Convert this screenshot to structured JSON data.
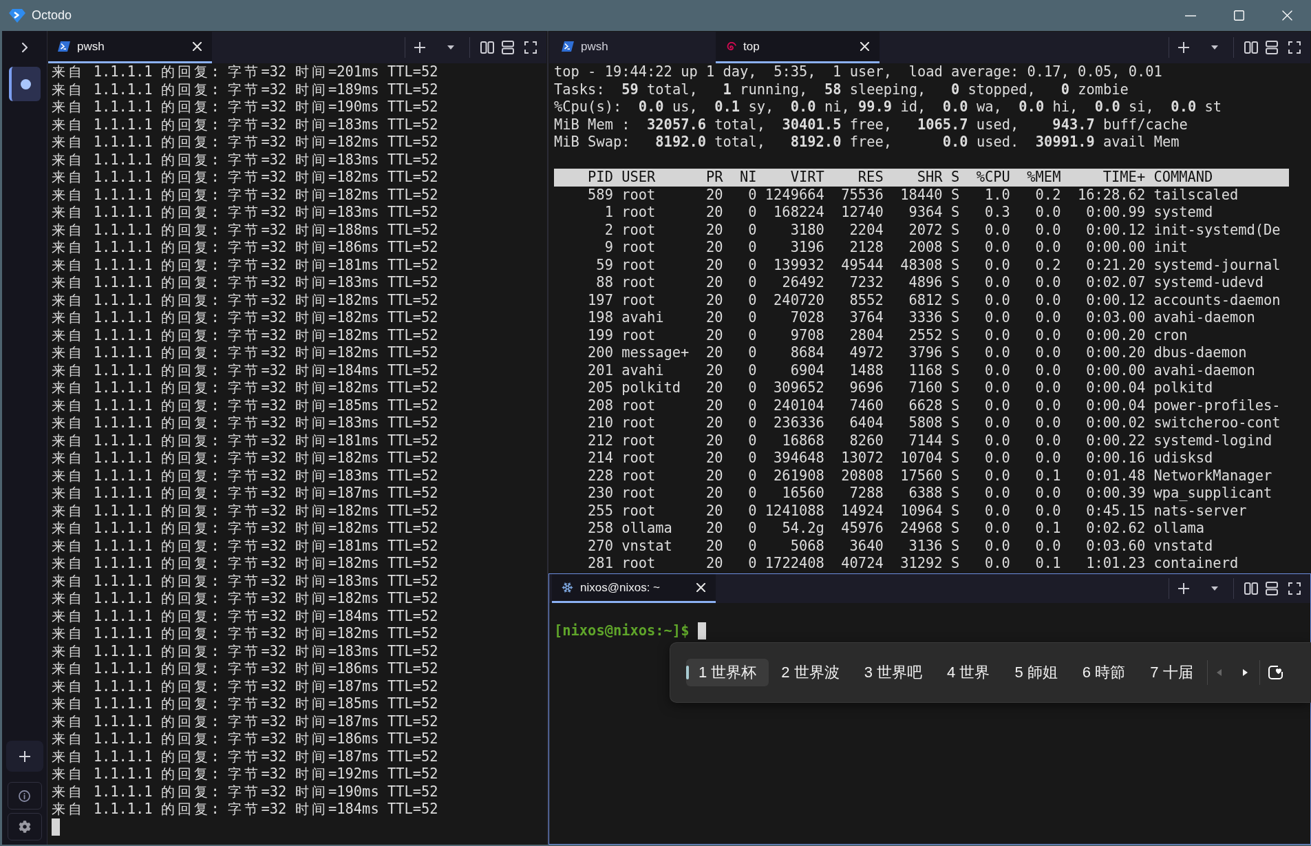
{
  "window": {
    "title": "Octodo"
  },
  "sidebar": {
    "sessions": [
      {
        "selected": true
      }
    ]
  },
  "panes": [
    {
      "kind": "output",
      "focused": false,
      "cursor": true,
      "tabs": [
        {
          "kind": "powershell",
          "label": "pwsh",
          "selected": true
        }
      ],
      "lines": [
        "来自 1.1.1.1 的回复: 字节=32 时间=201ms TTL=52",
        "来自 1.1.1.1 的回复: 字节=32 时间=189ms TTL=52",
        "来自 1.1.1.1 的回复: 字节=32 时间=190ms TTL=52",
        "来自 1.1.1.1 的回复: 字节=32 时间=183ms TTL=52",
        "来自 1.1.1.1 的回复: 字节=32 时间=182ms TTL=52",
        "来自 1.1.1.1 的回复: 字节=32 时间=183ms TTL=52",
        "来自 1.1.1.1 的回复: 字节=32 时间=182ms TTL=52",
        "来自 1.1.1.1 的回复: 字节=32 时间=182ms TTL=52",
        "来自 1.1.1.1 的回复: 字节=32 时间=183ms TTL=52",
        "来自 1.1.1.1 的回复: 字节=32 时间=188ms TTL=52",
        "来自 1.1.1.1 的回复: 字节=32 时间=186ms TTL=52",
        "来自 1.1.1.1 的回复: 字节=32 时间=181ms TTL=52",
        "来自 1.1.1.1 的回复: 字节=32 时间=183ms TTL=52",
        "来自 1.1.1.1 的回复: 字节=32 时间=182ms TTL=52",
        "来自 1.1.1.1 的回复: 字节=32 时间=182ms TTL=52",
        "来自 1.1.1.1 的回复: 字节=32 时间=182ms TTL=52",
        "来自 1.1.1.1 的回复: 字节=32 时间=182ms TTL=52",
        "来自 1.1.1.1 的回复: 字节=32 时间=184ms TTL=52",
        "来自 1.1.1.1 的回复: 字节=32 时间=182ms TTL=52",
        "来自 1.1.1.1 的回复: 字节=32 时间=185ms TTL=52",
        "来自 1.1.1.1 的回复: 字节=32 时间=183ms TTL=52",
        "来自 1.1.1.1 的回复: 字节=32 时间=181ms TTL=52",
        "来自 1.1.1.1 的回复: 字节=32 时间=182ms TTL=52",
        "来自 1.1.1.1 的回复: 字节=32 时间=183ms TTL=52",
        "来自 1.1.1.1 的回复: 字节=32 时间=187ms TTL=52",
        "来自 1.1.1.1 的回复: 字节=32 时间=182ms TTL=52",
        "来自 1.1.1.1 的回复: 字节=32 时间=182ms TTL=52",
        "来自 1.1.1.1 的回复: 字节=32 时间=181ms TTL=52",
        "来自 1.1.1.1 的回复: 字节=32 时间=182ms TTL=52",
        "来自 1.1.1.1 的回复: 字节=32 时间=183ms TTL=52",
        "来自 1.1.1.1 的回复: 字节=32 时间=182ms TTL=52",
        "来自 1.1.1.1 的回复: 字节=32 时间=184ms TTL=52",
        "来自 1.1.1.1 的回复: 字节=32 时间=182ms TTL=52",
        "来自 1.1.1.1 的回复: 字节=32 时间=183ms TTL=52",
        "来自 1.1.1.1 的回复: 字节=32 时间=186ms TTL=52",
        "来自 1.1.1.1 的回复: 字节=32 时间=187ms TTL=52",
        "来自 1.1.1.1 的回复: 字节=32 时间=185ms TTL=52",
        "来自 1.1.1.1 的回复: 字节=32 时间=187ms TTL=52",
        "来自 1.1.1.1 的回复: 字节=32 时间=186ms TTL=52",
        "来自 1.1.1.1 的回复: 字节=32 时间=187ms TTL=52",
        "来自 1.1.1.1 的回复: 字节=32 时间=192ms TTL=52",
        "来自 1.1.1.1 的回复: 字节=32 时间=190ms TTL=52",
        "来自 1.1.1.1 的回复: 字节=32 时间=184ms TTL=52"
      ]
    },
    {
      "kind": "process_monitor",
      "focused": false,
      "cursor": false,
      "tabs": [
        {
          "kind": "powershell",
          "label": "pwsh",
          "selected": false
        },
        {
          "kind": "debian",
          "label": "top",
          "selected": true
        }
      ],
      "summary": [
        "top - 19:44:22 up 1 day,  5:35,  1 user,  load average: 0.17, 0.05, 0.01",
        "Tasks:  **59** total,   **1** running,  **58** sleeping,   **0** stopped,   **0** zombie",
        "%Cpu(s):  **0.0** us,  **0.1** sy,  **0.0** ni, **99.9** id,  **0.0** wa,  **0.0** hi,  **0.0** si,  **0.0** st",
        "MiB Mem :  **32057.6** total,  **30401.5** free,   **1065.7** used,    **943.7** buff/cache",
        "MiB Swap:   **8192.0** total,   **8192.0** free,      **0.0** used.  **30991.9** avail Mem"
      ],
      "table": {
        "columns": [
          "PID",
          "USER",
          "PR",
          "NI",
          "VIRT",
          "RES",
          "SHR",
          "S",
          "%CPU",
          "%MEM",
          "TIME+",
          "COMMAND"
        ],
        "rows": [
          [
            "589",
            "root",
            "20",
            "0",
            "1249664",
            "75536",
            "18440",
            "S",
            "1.0",
            "0.2",
            "16:28.62",
            "tailscaled"
          ],
          [
            "1",
            "root",
            "20",
            "0",
            "168224",
            "12740",
            "9364",
            "S",
            "0.3",
            "0.0",
            "0:00.99",
            "systemd"
          ],
          [
            "2",
            "root",
            "20",
            "0",
            "3180",
            "2204",
            "2072",
            "S",
            "0.0",
            "0.0",
            "0:00.12",
            "init-systemd(De"
          ],
          [
            "9",
            "root",
            "20",
            "0",
            "3196",
            "2128",
            "2008",
            "S",
            "0.0",
            "0.0",
            "0:00.00",
            "init"
          ],
          [
            "59",
            "root",
            "20",
            "0",
            "139932",
            "49544",
            "48308",
            "S",
            "0.0",
            "0.2",
            "0:21.20",
            "systemd-journal"
          ],
          [
            "88",
            "root",
            "20",
            "0",
            "26492",
            "7232",
            "4896",
            "S",
            "0.0",
            "0.0",
            "0:02.07",
            "systemd-udevd"
          ],
          [
            "197",
            "root",
            "20",
            "0",
            "240720",
            "8552",
            "6812",
            "S",
            "0.0",
            "0.0",
            "0:00.12",
            "accounts-daemon"
          ],
          [
            "198",
            "avahi",
            "20",
            "0",
            "7028",
            "3764",
            "3336",
            "S",
            "0.0",
            "0.0",
            "0:03.00",
            "avahi-daemon"
          ],
          [
            "199",
            "root",
            "20",
            "0",
            "9708",
            "2804",
            "2552",
            "S",
            "0.0",
            "0.0",
            "0:00.20",
            "cron"
          ],
          [
            "200",
            "message+",
            "20",
            "0",
            "8684",
            "4972",
            "3796",
            "S",
            "0.0",
            "0.0",
            "0:00.20",
            "dbus-daemon"
          ],
          [
            "201",
            "avahi",
            "20",
            "0",
            "6904",
            "1488",
            "1168",
            "S",
            "0.0",
            "0.0",
            "0:00.00",
            "avahi-daemon"
          ],
          [
            "205",
            "polkitd",
            "20",
            "0",
            "309652",
            "9696",
            "7160",
            "S",
            "0.0",
            "0.0",
            "0:00.04",
            "polkitd"
          ],
          [
            "208",
            "root",
            "20",
            "0",
            "240104",
            "7460",
            "6628",
            "S",
            "0.0",
            "0.0",
            "0:00.04",
            "power-profiles-"
          ],
          [
            "210",
            "root",
            "20",
            "0",
            "236336",
            "6404",
            "5808",
            "S",
            "0.0",
            "0.0",
            "0:00.02",
            "switcheroo-cont"
          ],
          [
            "212",
            "root",
            "20",
            "0",
            "16868",
            "8260",
            "7144",
            "S",
            "0.0",
            "0.0",
            "0:00.22",
            "systemd-logind"
          ],
          [
            "214",
            "root",
            "20",
            "0",
            "394648",
            "13072",
            "10704",
            "S",
            "0.0",
            "0.0",
            "0:00.16",
            "udisksd"
          ],
          [
            "228",
            "root",
            "20",
            "0",
            "261908",
            "20808",
            "17560",
            "S",
            "0.0",
            "0.1",
            "0:01.48",
            "NetworkManager"
          ],
          [
            "230",
            "root",
            "20",
            "0",
            "16560",
            "7288",
            "6388",
            "S",
            "0.0",
            "0.0",
            "0:00.39",
            "wpa_supplicant"
          ],
          [
            "255",
            "root",
            "20",
            "0",
            "1241088",
            "14924",
            "10964",
            "S",
            "0.0",
            "0.0",
            "0:45.15",
            "nats-server"
          ],
          [
            "258",
            "ollama",
            "20",
            "0",
            "54.2g",
            "45976",
            "24968",
            "S",
            "0.0",
            "0.1",
            "0:02.62",
            "ollama"
          ],
          [
            "270",
            "vnstat",
            "20",
            "0",
            "5068",
            "3640",
            "3136",
            "S",
            "0.0",
            "0.0",
            "0:03.60",
            "vnstatd"
          ],
          [
            "281",
            "root",
            "20",
            "0",
            "1722408",
            "40724",
            "31292",
            "S",
            "0.0",
            "0.1",
            "1:01.23",
            "containerd"
          ]
        ]
      }
    },
    {
      "kind": "shell",
      "focused": true,
      "cursor": true,
      "tabs": [
        {
          "kind": "nixos",
          "label": "nixos@nixos: ~",
          "selected": true
        }
      ],
      "prompt": "[nixos@nixos:~]$",
      "ime": {
        "candidates": [
          {
            "label": "1 世界杯",
            "selected": true
          },
          {
            "label": "2 世界波",
            "selected": false
          },
          {
            "label": "3 世界吧",
            "selected": false
          },
          {
            "label": "4 世界",
            "selected": false
          },
          {
            "label": "5 師姐",
            "selected": false
          },
          {
            "label": "6 時節",
            "selected": false
          },
          {
            "label": "7 十届",
            "selected": false
          }
        ],
        "prev_page": {
          "disabled": true
        },
        "next_page": {
          "disabled": false
        }
      }
    }
  ]
}
